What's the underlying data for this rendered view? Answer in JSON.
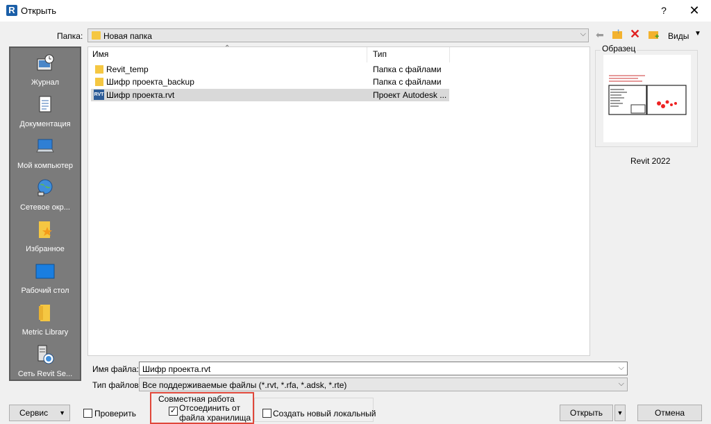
{
  "window": {
    "title": "Открыть",
    "app_icon": "R",
    "help": "?",
    "close": "✕"
  },
  "folder": {
    "label": "Папка:",
    "current": "Новая папка",
    "views_label": "Виды"
  },
  "sidebar": {
    "items": [
      {
        "label": "Журнал",
        "icon": "history-icon"
      },
      {
        "label": "Документация",
        "icon": "documents-icon"
      },
      {
        "label": "Мой компьютер",
        "icon": "computer-icon"
      },
      {
        "label": "Сетевое окр...",
        "icon": "network-icon"
      },
      {
        "label": "Избранное",
        "icon": "favorites-icon"
      },
      {
        "label": "Рабочий стол",
        "icon": "desktop-icon"
      },
      {
        "label": "Metric Library",
        "icon": "folder-icon"
      },
      {
        "label": "Сеть Revit Se...",
        "icon": "revit-server-icon"
      }
    ]
  },
  "filelist": {
    "columns": {
      "name": "Имя",
      "type": "Тип"
    },
    "rows": [
      {
        "name": "Revit_temp",
        "type": "Папка с файлами",
        "kind": "folder"
      },
      {
        "name": "Шифр проекта_backup",
        "type": "Папка с файлами",
        "kind": "folder"
      },
      {
        "name": "Шифр проекта.rvt",
        "type": "Проект Autodesk ...",
        "kind": "rvt"
      }
    ]
  },
  "preview": {
    "label": "Образец",
    "version": "Revit 2022"
  },
  "filename": {
    "label": "Имя файла:",
    "value": "Шифр проекта.rvt"
  },
  "filetype": {
    "label": "Тип файлов:",
    "value": "Все поддерживаемые файлы  (*.rvt, *.rfa, *.adsk, *.rte)"
  },
  "bottom": {
    "service": "Сервис",
    "verify": "Проверить",
    "collab_title": "Совместная работа",
    "detach_line1": "Отсоединить от",
    "detach_line2": "файла хранилища",
    "new_local": "Создать новый локальный",
    "open": "Открыть",
    "cancel": "Отмена"
  },
  "colors": {
    "sidebar_bg": "#7b7b7b",
    "highlight": "#e0473a",
    "selected_row": "#d9d9d9"
  }
}
